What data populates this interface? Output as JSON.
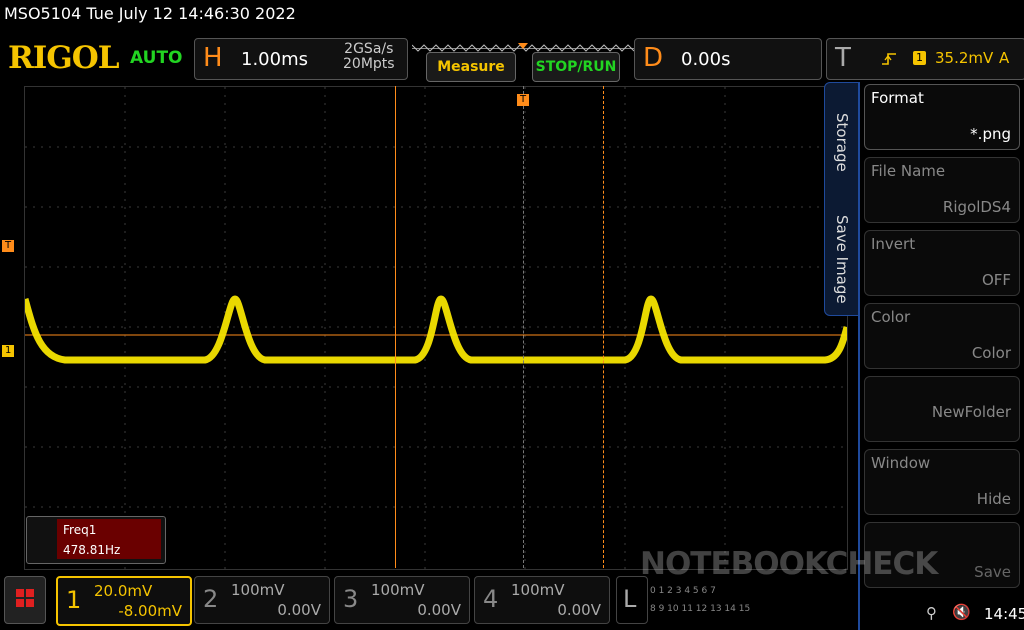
{
  "title": "MSO5104  Tue July 12 14:46:30 2022",
  "brand": "RIGOL",
  "trigger_mode": "AUTO",
  "horizontal": {
    "letter": "H",
    "scale": "1.00ms",
    "sample_rate": "2GSa/s",
    "memory_depth": "20Mpts"
  },
  "buttons": {
    "measure": "Measure",
    "stop_run": "STOP/RUN"
  },
  "delay": {
    "letter": "D",
    "value": "0.00s"
  },
  "trigger": {
    "letter": "T",
    "channel_badge": "1",
    "level": "35.2mV",
    "coupling": "A"
  },
  "side_tabs": {
    "storage": "Storage",
    "save_image": "Save Image"
  },
  "menu": [
    {
      "label": "Format",
      "value": "*.png"
    },
    {
      "label": "File Name",
      "value": "RigolDS4"
    },
    {
      "label": "Invert",
      "value": "OFF"
    },
    {
      "label": "Color",
      "value": "Color"
    },
    {
      "label": "",
      "value": "NewFolder"
    },
    {
      "label": "Window",
      "value": "Hide"
    },
    {
      "label": "",
      "value": "Save"
    }
  ],
  "freq_measure": {
    "label": "Freq1",
    "value": "478.81Hz"
  },
  "marker_labels": {
    "trigger": "T",
    "ch1": "1",
    "trig_top": "T"
  },
  "channels": [
    {
      "num": "1",
      "scale": "20.0mV",
      "offset": "-8.00mV",
      "color": "#f5c400"
    },
    {
      "num": "2",
      "scale": "100mV",
      "offset": "0.00V",
      "color": "#888888"
    },
    {
      "num": "3",
      "scale": "100mV",
      "offset": "0.00V",
      "color": "#888888"
    },
    {
      "num": "4",
      "scale": "100mV",
      "offset": "0.00V",
      "color": "#888888"
    }
  ],
  "logic": {
    "letter": "L",
    "bits_top": "0 1 2 3 4 5 6 7",
    "bits_bottom": "8 9 10 11 12 13 14 15"
  },
  "watermark": "NOTEBOOKCHECK",
  "clock": "14:45",
  "colors": {
    "accent_orange": "#ff8c1a",
    "ch1_yellow": "#f5c400",
    "green": "#22d422",
    "menu_blue": "#1f4a9c"
  }
}
